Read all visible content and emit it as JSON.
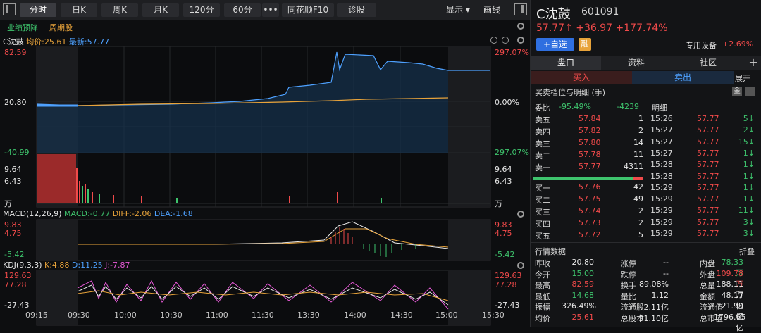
{
  "toolbar": {
    "tabs": [
      "分时",
      "日K",
      "周K",
      "月K",
      "120分",
      "60分",
      "•••",
      "同花顺F10",
      "诊股"
    ],
    "right_buttons": [
      "显示 ▾",
      "画线"
    ]
  },
  "chart": {
    "tags": [
      "业绩预降",
      "周期股"
    ],
    "legend_name": "C沈鼓",
    "legend_avg": "均价:25.61",
    "legend_latest": "最新:57.77",
    "price_axis_left": [
      "82.59",
      "20.80",
      "-40.99"
    ],
    "price_axis_right": [
      "297.07%",
      "0.00%",
      "297.07%"
    ],
    "vol_axis_left": [
      "9.64",
      "6.43",
      "万"
    ],
    "vol_axis_right": [
      "9.64",
      "6.43",
      "万"
    ],
    "macd_title": "MACD(12,26,9)",
    "macd_value": "MACD:-0.77",
    "diff_value": "DIFF:-2.06",
    "dea_value": "DEA:-1.68",
    "macd_axis_left": [
      "9.83",
      "4.75",
      "-5.42"
    ],
    "macd_axis_right": [
      "9.83",
      "4.75",
      "-5.42"
    ],
    "kdj_title": "KDJ(9,3,3)",
    "k_value": "K:4.88",
    "d_value": "D:11.25",
    "j_value": "J:-7.87",
    "kdj_axis_left": [
      "129.63",
      "77.28",
      "-27.43"
    ],
    "kdj_axis_right": [
      "129.63",
      "77.28",
      "-27.43"
    ],
    "x_ticks": [
      "09:15",
      "09:30",
      "10:00",
      "10:30",
      "11:00",
      "11:30",
      "13:30",
      "14:00",
      "14:30",
      "15:00",
      "15:30"
    ]
  },
  "stock": {
    "name": "C沈鼓",
    "code": "601091",
    "price": "57.77",
    "change": "+36.97",
    "change_pct": "+177.74%",
    "watch_label": "+自选",
    "margin_label": "融",
    "sector": "专用设备",
    "sector_pct": "+2.69%"
  },
  "tabs": [
    "盘口",
    "资料",
    "社区"
  ],
  "trade_tabs": {
    "buy": "买入",
    "sell": "卖出",
    "expand": "展开"
  },
  "order_book": {
    "title": "买卖档位与明细 (手)",
    "badge": "金",
    "ratio_label": "委比",
    "ratio_pct": "-95.49%",
    "ratio_diff": "-4239",
    "detail_label": "明细",
    "asks": [
      {
        "label": "卖五",
        "price": "57.84",
        "vol": "1"
      },
      {
        "label": "卖四",
        "price": "57.82",
        "vol": "2"
      },
      {
        "label": "卖三",
        "price": "57.80",
        "vol": "14"
      },
      {
        "label": "卖二",
        "price": "57.78",
        "vol": "11"
      },
      {
        "label": "卖一",
        "price": "57.77",
        "vol": "4311"
      }
    ],
    "bids": [
      {
        "label": "买一",
        "price": "57.76",
        "vol": "42"
      },
      {
        "label": "买二",
        "price": "57.75",
        "vol": "49"
      },
      {
        "label": "买三",
        "price": "57.74",
        "vol": "2"
      },
      {
        "label": "买四",
        "price": "57.73",
        "vol": "2"
      },
      {
        "label": "买五",
        "price": "57.72",
        "vol": "5"
      }
    ],
    "ticks": [
      {
        "time": "15:26",
        "price": "57.77",
        "vol": "5"
      },
      {
        "time": "15:27",
        "price": "57.77",
        "vol": "2"
      },
      {
        "time": "15:27",
        "price": "57.77",
        "vol": "15"
      },
      {
        "time": "15:27",
        "price": "57.77",
        "vol": "1"
      },
      {
        "time": "15:28",
        "price": "57.77",
        "vol": "1"
      },
      {
        "time": "15:28",
        "price": "57.77",
        "vol": "1"
      },
      {
        "time": "15:29",
        "price": "57.77",
        "vol": "1"
      },
      {
        "time": "15:29",
        "price": "57.77",
        "vol": "1"
      },
      {
        "time": "15:29",
        "price": "57.77",
        "vol": "11"
      },
      {
        "time": "15:29",
        "price": "57.77",
        "vol": "3"
      },
      {
        "time": "15:29",
        "price": "57.77",
        "vol": "3"
      }
    ]
  },
  "quote": {
    "title": "行情数据",
    "fold": "折叠",
    "rows": [
      [
        "昨收",
        "20.80",
        "涨停",
        "--",
        "内盘",
        "78.33万"
      ],
      [
        "今开",
        "15.00",
        "跌停",
        "--",
        "外盘",
        "109.78万"
      ],
      [
        "最高",
        "82.59",
        "换手",
        "89.08%",
        "总量",
        "188.11万"
      ],
      [
        "最低",
        "14.68",
        "量比",
        "1.12",
        "金额",
        "48.17亿"
      ],
      [
        "振幅",
        "326.49%",
        "流通股",
        "2.11亿",
        "流通值",
        "121.99亿"
      ],
      [
        "均价",
        "25.61",
        "总股本",
        "31.10亿",
        "总市值",
        "1796.65亿"
      ]
    ]
  }
}
